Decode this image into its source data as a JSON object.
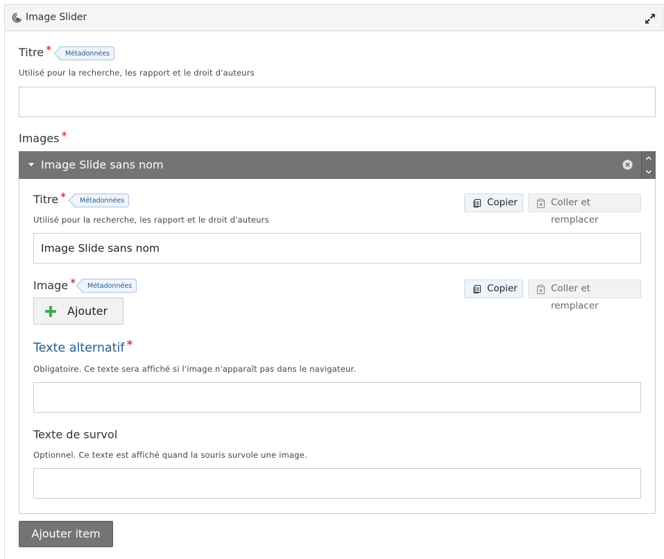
{
  "header": {
    "title": "Image Slider"
  },
  "title_field": {
    "label": "Titre",
    "required_mark": "*",
    "meta_tag": "Métadonnées",
    "description": "Utilisé pour la recherche, les rapport et le droit d'auteurs",
    "value": ""
  },
  "images": {
    "label": "Images",
    "required_mark": "*",
    "slide": {
      "header_title": "Image Slide sans nom",
      "titre": {
        "label": "Titre",
        "required_mark": "*",
        "meta_tag": "Métadonnées",
        "description": "Utilisé pour la recherche, les rapport et le droit d'auteurs",
        "value": "Image Slide sans nom",
        "copy_label": "Copier",
        "paste_label": "Coller et remplacer"
      },
      "image": {
        "label": "Image",
        "required_mark": "*",
        "meta_tag": "Métadonnées",
        "add_label": "Ajouter",
        "copy_label": "Copier",
        "paste_label": "Coller et remplacer"
      },
      "alt_text": {
        "label": "Texte alternatif",
        "required_mark": "*",
        "description": "Obligatoire. Ce texte sera affiché si l'image n'apparaît pas dans le navigateur.",
        "value": ""
      },
      "hover_text": {
        "label": "Texte de survol",
        "description": "Optionnel. Ce texte est affiché quand la souris survole une image.",
        "value": ""
      }
    },
    "add_item_label": "Ajouter item"
  },
  "colors": {
    "slide_header_bg": "#767373",
    "required": "#dd0000",
    "meta_tag_text": "#2a5d8c",
    "alt_label": "#2a5d8c",
    "plus_icon": "#3cb043"
  }
}
